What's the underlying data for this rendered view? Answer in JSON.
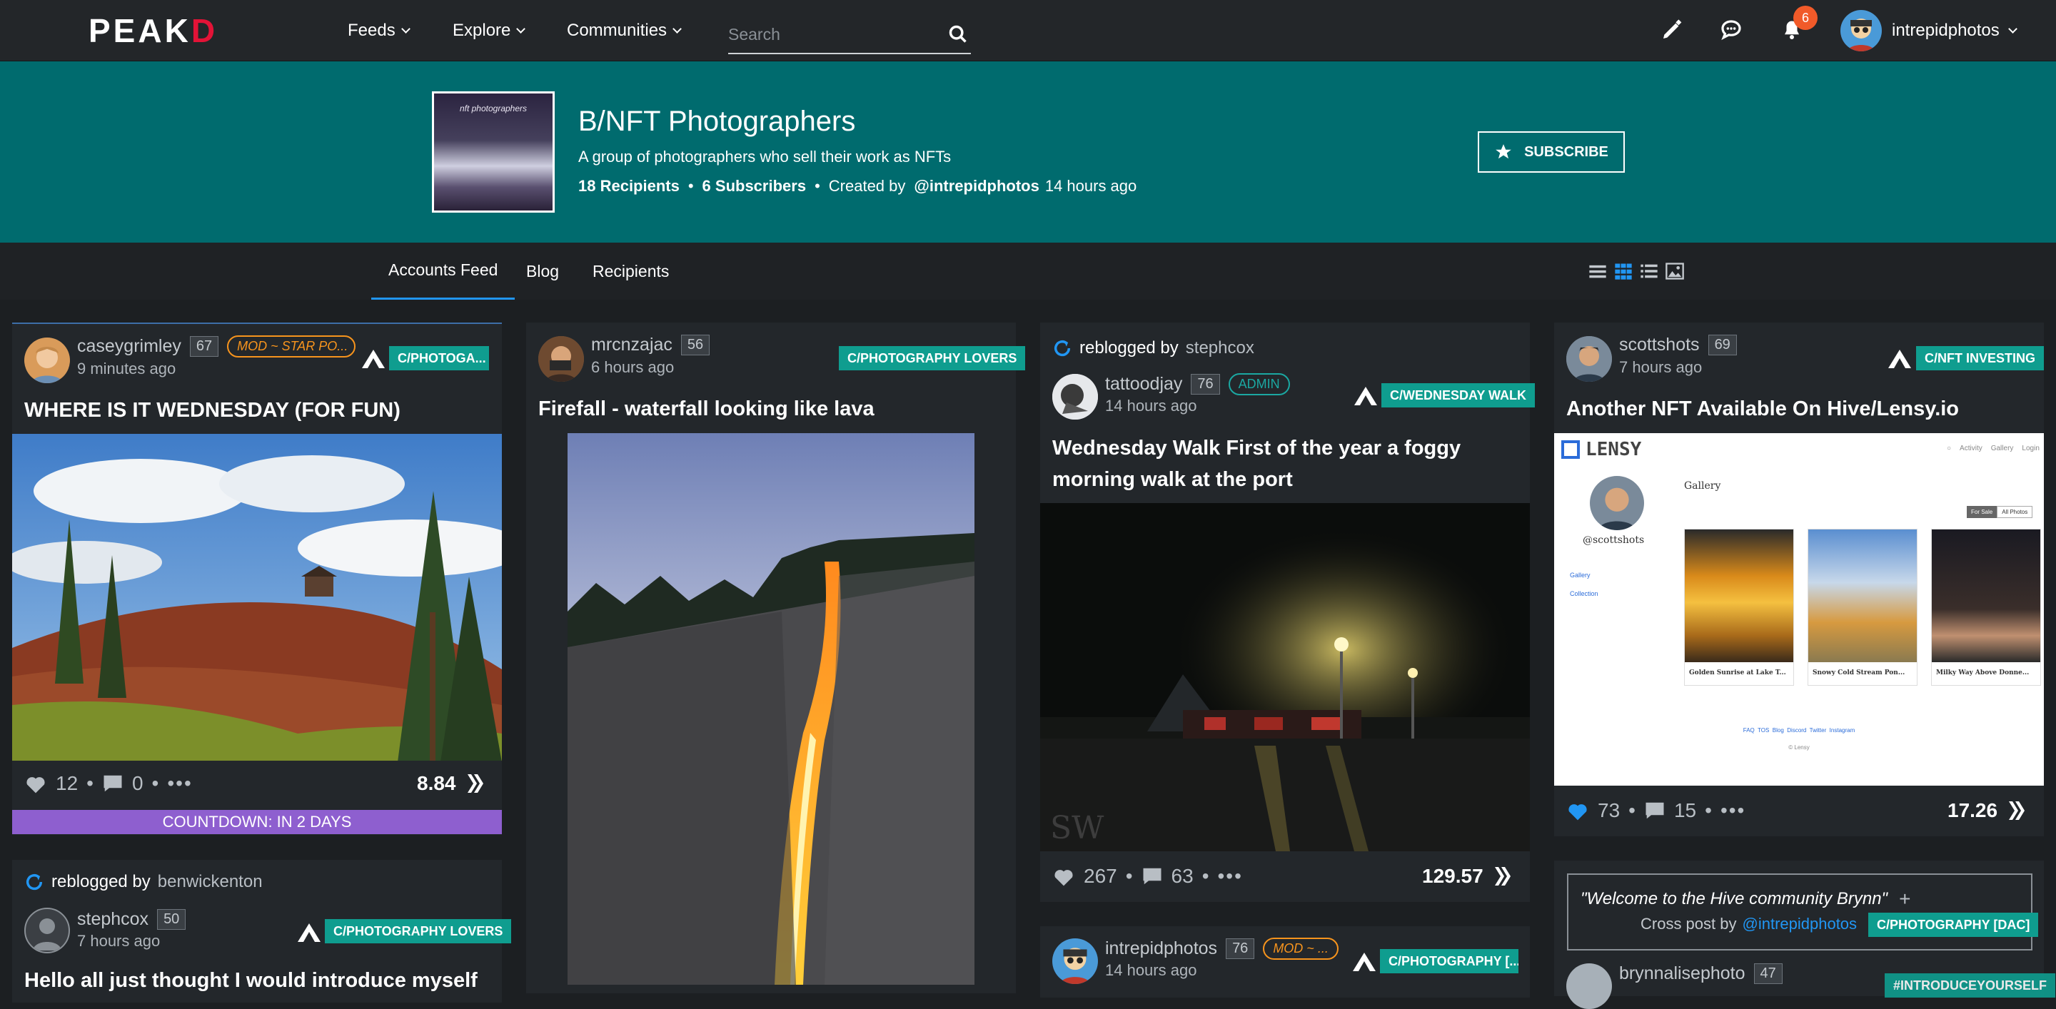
{
  "nav": {
    "logo_a": "PE",
    "logo_b": "A",
    "logo_c": "K",
    "logo_d": "D",
    "feeds": "Feeds",
    "explore": "Explore",
    "communities": "Communities",
    "search_placeholder": "Search",
    "notifications_count": "6",
    "username": "intrepidphotos"
  },
  "community": {
    "cover_text": "nft photographers",
    "title": "B/NFT Photographers",
    "description": "A group of photographers who sell their work as NFTs",
    "recipients": "18 Recipients",
    "subscribers": "6 Subscribers",
    "created_by_label": "Created by",
    "created_by_user": "@intrepidphotos",
    "created_ago": "14 hours ago",
    "subscribe_label": "SUBSCRIBE"
  },
  "tabs": [
    "Accounts Feed",
    "Blog",
    "Recipients"
  ],
  "posts": [
    {
      "author": "caseygrimley",
      "rep": "67",
      "ago": "9 minutes ago",
      "mod_tag": "MOD ~ STAR PO...",
      "community": "C/PHOTOGA...",
      "title": "WHERE IS IT WEDNESDAY (FOR FUN)",
      "votes": "12",
      "comments": "0",
      "payout": "8.84",
      "countdown": "COUNTDOWN: IN 2 DAYS"
    },
    {
      "author": "mrcnzajac",
      "rep": "56",
      "ago": "6 hours ago",
      "community": "C/PHOTOGRAPHY LOVERS",
      "title": "Firefall - waterfall looking like lava"
    },
    {
      "reblog_label": "reblogged by",
      "reblog_user": "stephcox",
      "author": "tattoodjay",
      "rep": "76",
      "ago": "14 hours ago",
      "admin_tag": "ADMIN",
      "community": "C/WEDNESDAY WALK",
      "title_line1": "Wednesday Walk First of the year a foggy",
      "title_line2": "morning walk at the port",
      "votes": "267",
      "comments": "63",
      "payout": "129.57"
    },
    {
      "author": "scottshots",
      "rep": "69",
      "ago": "7 hours ago",
      "community": "C/NFT INVESTING",
      "title": "Another NFT Available On Hive/Lensy.io",
      "votes": "73",
      "comments": "15",
      "payout": "17.26"
    },
    {
      "reblog_label": "reblogged by",
      "reblog_user": "benwickenton",
      "author": "stephcox",
      "rep": "50",
      "ago": "7 hours ago",
      "community": "C/PHOTOGRAPHY LOVERS",
      "title": "Hello all just thought I would introduce myself"
    },
    {
      "author": "intrepidphotos",
      "rep": "76",
      "ago": "14 hours ago",
      "mod_tag": "MOD ~ ...",
      "community": "C/PHOTOGRAPHY [..."
    },
    {
      "quote": "\"Welcome to the Hive community Brynn\"",
      "crosspost_label": "Cross post by",
      "crosspost_user": "@intrepidphotos",
      "community": "C/PHOTOGRAPHY [DAC]",
      "author": "brynnalisephoto",
      "rep": "47",
      "tag2": "#INTRODUCEYOURSELF"
    }
  ],
  "lensy": {
    "brand": "LENSY",
    "nav_activity": "Activity",
    "nav_gallery": "Gallery",
    "nav_login": "Login",
    "heading": "Gallery",
    "user": "@scottshots",
    "side_gallery": "Gallery",
    "side_collection": "Collection",
    "btn_forsale": "For Sale",
    "btn_all": "All Photos",
    "photos": [
      "Golden Sunrise at Lake T...",
      "Snowy Cold Stream Pon...",
      "Milky Way Above Donne..."
    ],
    "footer_links": "FAQ  TOS  Blog  Discord  Twitter  Instagram",
    "copyright": "© Lensy"
  },
  "colors": {
    "banner": "#006b6e",
    "tag": "#0f9d8f",
    "accent": "#2196f3",
    "mod": "#f7941d",
    "countdown": "#8e5fcf"
  }
}
